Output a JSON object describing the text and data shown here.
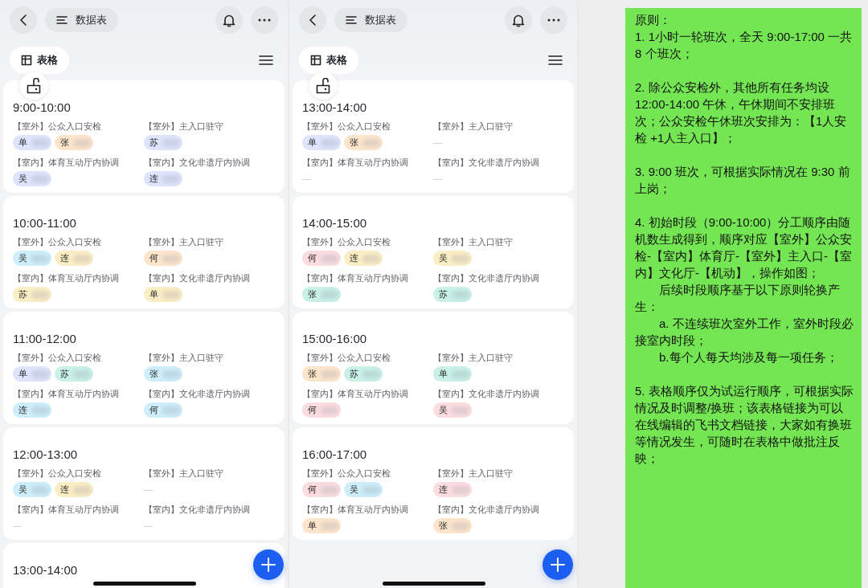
{
  "phones": [
    {
      "nav": {
        "title": "数据表"
      },
      "view_tab": {
        "label": "表格"
      },
      "cards": [
        {
          "time": "9:00-10:00",
          "fields": [
            {
              "label": "【室外】公众入口安检",
              "people": [
                {
                  "name": "单",
                  "color": "#dde4fb"
                },
                {
                  "name": "张",
                  "color": "#fde5cc"
                }
              ]
            },
            {
              "label": "【室外】主入口驻守",
              "people": [
                {
                  "name": "苏",
                  "color": "#dde4fb"
                }
              ]
            },
            {
              "label": "【室内】体育互动厅内协调",
              "people": [
                {
                  "name": "吴",
                  "color": "#dde4fb"
                }
              ]
            },
            {
              "label": "【室内】文化非遗厅内协调",
              "people": [
                {
                  "name": "连",
                  "color": "#dde4fb"
                }
              ]
            }
          ]
        },
        {
          "time": "10:00-11:00",
          "fields": [
            {
              "label": "【室外】公众入口安检",
              "people": [
                {
                  "name": "吴",
                  "color": "#cdeefa"
                },
                {
                  "name": "连",
                  "color": "#fbedc4"
                }
              ]
            },
            {
              "label": "【室外】主入口驻守",
              "people": [
                {
                  "name": "何",
                  "color": "#fde5cc"
                }
              ]
            },
            {
              "label": "【室内】体育互动厅内协调",
              "people": [
                {
                  "name": "苏",
                  "color": "#fbedc4"
                }
              ]
            },
            {
              "label": "【室内】文化非遗厅内协调",
              "people": [
                {
                  "name": "单",
                  "color": "#fbedc4"
                }
              ]
            }
          ]
        },
        {
          "time": "11:00-12:00",
          "fields": [
            {
              "label": "【室外】公众入口安检",
              "people": [
                {
                  "name": "单",
                  "color": "#dde4fb"
                },
                {
                  "name": "苏",
                  "color": "#c9f1e8"
                }
              ]
            },
            {
              "label": "【室外】主入口驻守",
              "people": [
                {
                  "name": "张",
                  "color": "#cdeefa"
                }
              ]
            },
            {
              "label": "【室内】体育互动厅内协调",
              "people": [
                {
                  "name": "连",
                  "color": "#cdeefa"
                }
              ]
            },
            {
              "label": "【室内】文化非遗厅内协调",
              "people": [
                {
                  "name": "何",
                  "color": "#cdeefa"
                }
              ]
            }
          ]
        },
        {
          "time": "12:00-13:00",
          "fields": [
            {
              "label": "【室外】公众入口安检",
              "people": [
                {
                  "name": "吴",
                  "color": "#cdeefa"
                },
                {
                  "name": "连",
                  "color": "#fbedc4"
                }
              ]
            },
            {
              "label": "【室外】主入口驻守",
              "value": "—"
            },
            {
              "label": "【室内】体育互动厅内协调",
              "value": "—"
            },
            {
              "label": "【室内】文化非遗厅内协调",
              "value": "—"
            }
          ]
        },
        {
          "time": "13:00-14:00"
        }
      ]
    },
    {
      "nav": {
        "title": "数据表"
      },
      "view_tab": {
        "label": "表格"
      },
      "cards": [
        {
          "time": "13:00-14:00",
          "fields": [
            {
              "label": "【室外】公众入口安检",
              "people": [
                {
                  "name": "单",
                  "color": "#dde4fb"
                },
                {
                  "name": "张",
                  "color": "#fde5cc"
                }
              ]
            },
            {
              "label": "【室外】主入口驻守",
              "value": "—"
            },
            {
              "label": "【室内】体育互动厅内协调",
              "value": "—"
            },
            {
              "label": "【室内】文化非遗厅内协调",
              "value": "—"
            }
          ]
        },
        {
          "time": "14:00-15:00",
          "fields": [
            {
              "label": "【室外】公众入口安检",
              "people": [
                {
                  "name": "何",
                  "color": "#fbdde0"
                },
                {
                  "name": "连",
                  "color": "#fbedc4"
                }
              ]
            },
            {
              "label": "【室外】主入口驻守",
              "people": [
                {
                  "name": "吴",
                  "color": "#fbedc4"
                }
              ]
            },
            {
              "label": "【室内】体育互动厅内协调",
              "people": [
                {
                  "name": "张",
                  "color": "#c9f1e8"
                }
              ]
            },
            {
              "label": "【室内】文化非遗厅内协调",
              "people": [
                {
                  "name": "苏",
                  "color": "#c9f1e8"
                }
              ]
            }
          ]
        },
        {
          "time": "15:00-16:00",
          "fields": [
            {
              "label": "【室外】公众入口安检",
              "people": [
                {
                  "name": "张",
                  "color": "#fde5cc"
                },
                {
                  "name": "苏",
                  "color": "#c9f1e8"
                }
              ]
            },
            {
              "label": "【室外】主入口驻守",
              "people": [
                {
                  "name": "单",
                  "color": "#c9f1e8"
                }
              ]
            },
            {
              "label": "【室内】体育互动厅内协调",
              "people": [
                {
                  "name": "何",
                  "color": "#fbdde0"
                }
              ]
            },
            {
              "label": "【室内】文化非遗厅内协调",
              "people": [
                {
                  "name": "吴",
                  "color": "#fbdde0"
                }
              ]
            }
          ]
        },
        {
          "time": "16:00-17:00",
          "fields": [
            {
              "label": "【室外】公众入口安检",
              "people": [
                {
                  "name": "何",
                  "color": "#fbdde0"
                },
                {
                  "name": "吴",
                  "color": "#cdeefa"
                }
              ]
            },
            {
              "label": "【室外】主入口驻守",
              "people": [
                {
                  "name": "连",
                  "color": "#fbdde0"
                }
              ]
            },
            {
              "label": "【室内】体育互动厅内协调",
              "people": [
                {
                  "name": "单",
                  "color": "#fde5cc"
                }
              ]
            },
            {
              "label": "【室内】文化非遗厅内协调",
              "people": [
                {
                  "name": "张",
                  "color": "#fde5cc"
                }
              ]
            }
          ]
        }
      ]
    }
  ],
  "chat_message": {
    "paragraphs": [
      {
        "text": "原则：",
        "indent": false,
        "break_before": false
      },
      {
        "text": "1. 1小时一轮班次，全天 9:00-17:00 一共 8 个班次；",
        "indent": false,
        "break_before": false
      },
      {
        "text": "2. 除公众安检外，其他所有任务均设 12:00-14:00 午休，午休期间不安排班次；公众安检午休班次安排为：【1人安检 +1人主入口】；",
        "indent": false,
        "break_before": true
      },
      {
        "text": "3. 9:00 班次，可根据实际情况在 9:30 前上岗；",
        "indent": false,
        "break_before": true
      },
      {
        "text": "4. 初始时段（9:00-10:00）分工顺序由随机数生成得到，顺序对应【室外】公众安检-【室内】体育厅-【室外】主入口-【室内】文化厅-【机动】，操作如图；",
        "indent": false,
        "break_before": true
      },
      {
        "text": "后续时段顺序基于以下原则轮换产生：",
        "indent": true,
        "break_before": false
      },
      {
        "text": "a. 不连续班次室外工作，室外时段必接室内时段；",
        "indent": true,
        "break_before": false
      },
      {
        "text": "b.每个人每天均涉及每一项任务；",
        "indent": true,
        "break_before": false
      },
      {
        "text": "5. 表格顺序仅为试运行顺序，可根据实际情况及时调整/换班；该表格链接为可以在线编辑的飞书文档链接，大家如有换班等情况发生，可随时在表格中做批注反映；",
        "indent": false,
        "break_before": true
      }
    ]
  }
}
